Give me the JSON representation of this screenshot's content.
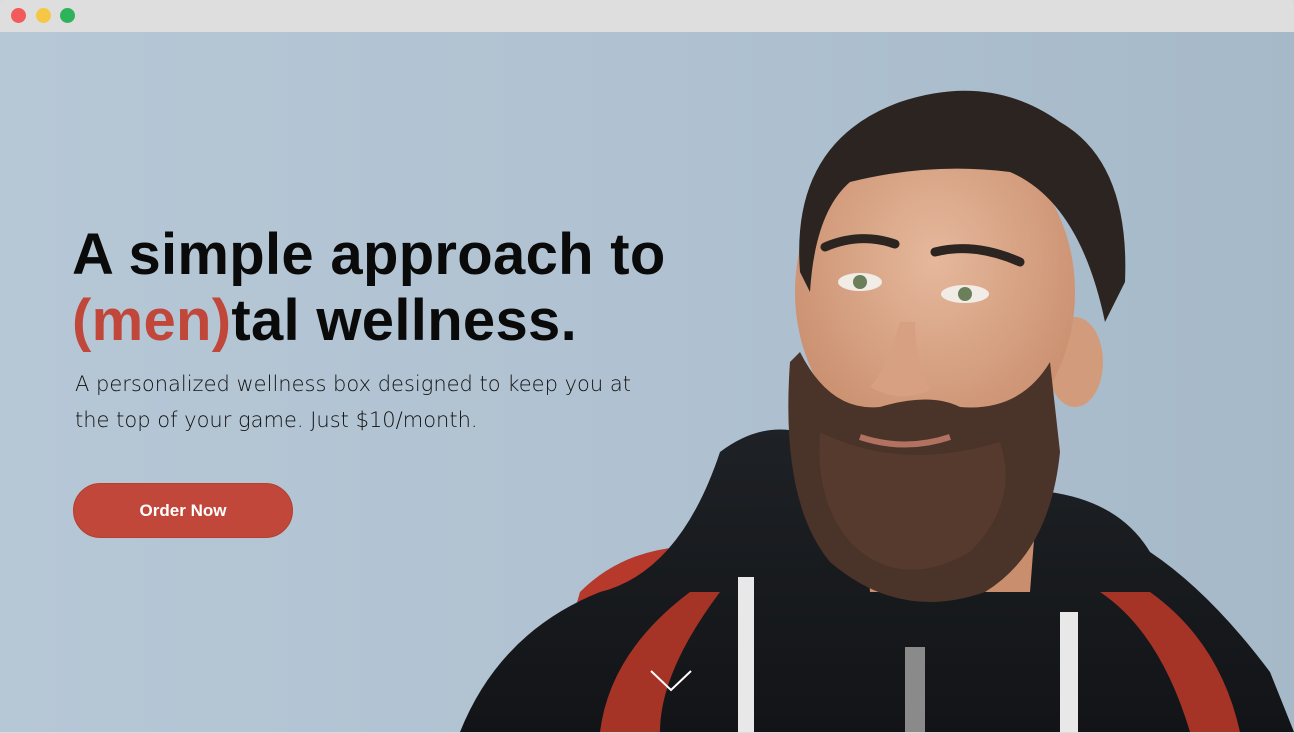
{
  "hero": {
    "headline_line1": "A simple approach to",
    "headline_accent": "(men)",
    "headline_rest": "tal wellness.",
    "subtext": "A personalized wellness box designed to keep you at the top of your game. Just $10/month.",
    "cta_label": "Order Now",
    "scroll_icon": "chevron-down-icon"
  },
  "colors": {
    "accent": "#c0473a",
    "background": "#b3c4d3",
    "text": "#0a0a0a"
  },
  "window_controls": [
    "close",
    "minimize",
    "maximize"
  ]
}
